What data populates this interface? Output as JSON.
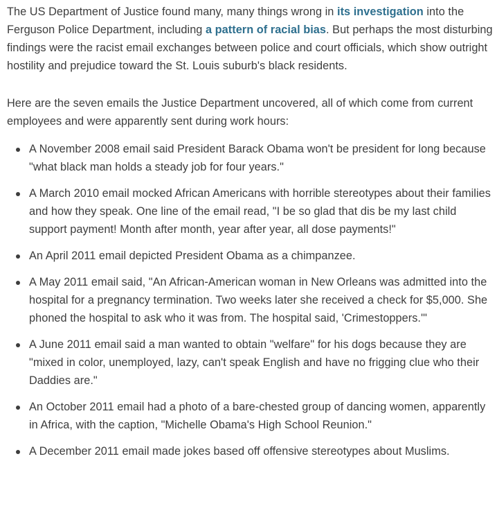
{
  "intro": {
    "part1": "The US Department of Justice found many, many things wrong in ",
    "link1": "its investigation",
    "part2": " into the Ferguson Police Department, including ",
    "link2": "a pattern of racial bias",
    "part3": ". But perhaps the most disturbing findings were the racist email exchanges between police and court officials, which show outright hostility and prejudice toward the St. Louis suburb's black residents."
  },
  "lead": "Here are the seven emails the Justice Department uncovered, all of which come from current employees and were apparently sent during work hours:",
  "emails": [
    "A November 2008 email said President Barack Obama won't be president for long because \"what black man holds a steady job for four years.\"",
    "A March 2010 email mocked African Americans with horrible stereotypes about their families and how they speak. One line of the email read, \"I be so glad that dis be my last child support payment! Month after month, year after year, all dose payments!\"",
    "An April 2011 email depicted President Obama as a chimpanzee.",
    "A May 2011 email said, \"An African-American woman in New Orleans was admitted into the hospital for a pregnancy termination. Two weeks later she received a check for $5,000. She phoned the hospital to ask who it was from. The hospital said, 'Crimestoppers.'\"",
    "A June 2011 email said a man wanted to obtain \"welfare\" for his dogs because they are \"mixed in color, unemployed, lazy, can't speak English and have no frigging clue who their Daddies are.\"",
    "An October 2011 email had a photo of a bare-chested group of dancing women, apparently in Africa, with the caption, \"Michelle Obama's High School Reunion.\"",
    "A December 2011 email made jokes based off offensive stereotypes about Muslims."
  ],
  "colors": {
    "text": "#3d3d3d",
    "link": "#2e6f8e",
    "background": "#ffffff"
  }
}
